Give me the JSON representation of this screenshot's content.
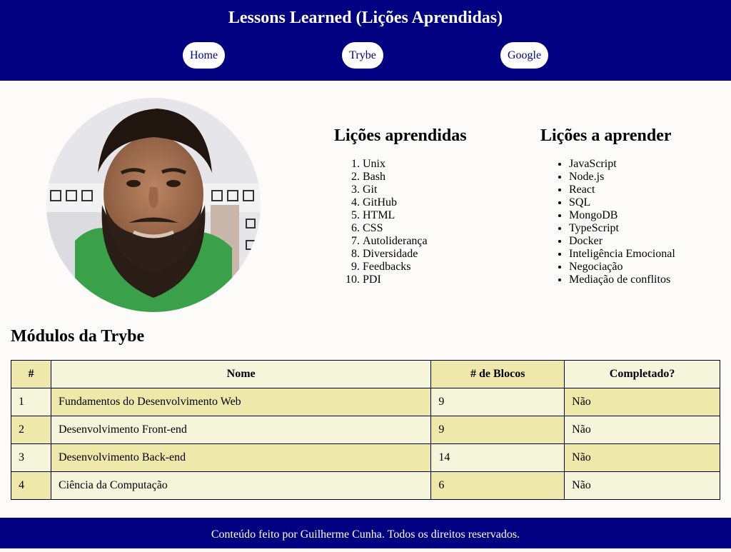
{
  "header": {
    "title": "Lessons Learned (Lições Aprendidas)",
    "nav": [
      {
        "label": "Home"
      },
      {
        "label": "Trybe"
      },
      {
        "label": "Google"
      }
    ],
    "background_color": "#000080"
  },
  "lessons_learned": {
    "heading": "Lições aprendidas",
    "items": [
      "Unix",
      "Bash",
      "Git",
      "GitHub",
      "HTML",
      "CSS",
      "Autoliderança",
      "Diversidade",
      "Feedbacks",
      "PDI"
    ]
  },
  "lessons_to_learn": {
    "heading": "Lições a aprender",
    "items": [
      "JavaScript",
      "Node.js",
      "React",
      "SQL",
      "MongoDB",
      "TypeScript",
      "Docker",
      "Inteligência Emocional",
      "Negociação",
      "Mediação de conflitos"
    ]
  },
  "modules": {
    "title": "Módulos da Trybe",
    "columns": [
      "#",
      "Nome",
      "# de Blocos",
      "Completado?"
    ],
    "rows": [
      [
        "1",
        "Fundamentos do Desenvolvimento Web",
        "9",
        "Não"
      ],
      [
        "2",
        "Desenvolvimento Front-end",
        "9",
        "Não"
      ],
      [
        "3",
        "Desenvolvimento Back-end",
        "14",
        "Não"
      ],
      [
        "4",
        "Ciência da Computação",
        "6",
        "Não"
      ]
    ],
    "colors": {
      "light": "#f5f5dc",
      "dark": "#eee8aa"
    }
  },
  "footer": {
    "text": "Conteúdo feito por Guilherme Cunha. Todos os direitos reservados."
  }
}
